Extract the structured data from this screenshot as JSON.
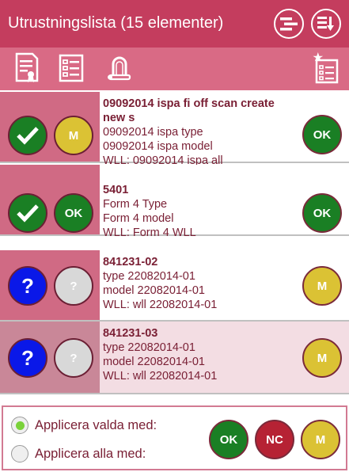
{
  "header": {
    "title": "Utrustningslista (15 elementer)",
    "buttons": [
      {
        "name": "filter-list-icon"
      },
      {
        "name": "sort-download-icon"
      }
    ]
  },
  "toolbar": {
    "icons": [
      "certificate-document-icon",
      "checklist-icon",
      "shackle-icon",
      "new-checklist-icon"
    ]
  },
  "items": [
    {
      "status": "check",
      "status_color": "#1a7f24",
      "category": "M",
      "category_color": "#dbc234",
      "name": "09092014 ispa fi off scan create new s",
      "type": "09092014 ispa type",
      "model": "09092014 ispa model",
      "wll": "WLL: 09092014 ispa all",
      "action": "OK",
      "action_color": "#1a7f24",
      "selected": false
    },
    {
      "status": "check",
      "status_color": "#1a7f24",
      "category": "OK",
      "category_color": "#1a7f24",
      "name": "5401",
      "type": "Form 4 Type",
      "model": "Form 4 model",
      "wll": "WLL: Form 4 WLL",
      "action": "OK",
      "action_color": "#1a7f24",
      "selected": false
    },
    {
      "status": "?",
      "status_color": "#0a18e8",
      "category": "?",
      "category_color": "#d8d8d8",
      "name": "841231-02",
      "type": "type 22082014-01",
      "model": "model 22082014-01",
      "wll": "WLL: wll 22082014-01",
      "action": "M",
      "action_color": "#dbc234",
      "selected": false
    },
    {
      "status": "?",
      "status_color": "#0a18e8",
      "category": "?",
      "category_color": "#d8d8d8",
      "name": "841231-03",
      "type": "type 22082014-01",
      "model": "model 22082014-01",
      "wll": "WLL: wll 22082014-01",
      "action": "M",
      "action_color": "#dbc234",
      "selected": true
    }
  ],
  "footer": {
    "apply_selected_label": "Applicera valda med:",
    "apply_all_label": "Applicera alla med:",
    "apply_selected_checked": true,
    "buttons": [
      {
        "label": "OK",
        "color": "#1a7f24"
      },
      {
        "label": "NC",
        "color": "#b62234"
      },
      {
        "label": "M",
        "color": "#dbc234"
      }
    ]
  }
}
